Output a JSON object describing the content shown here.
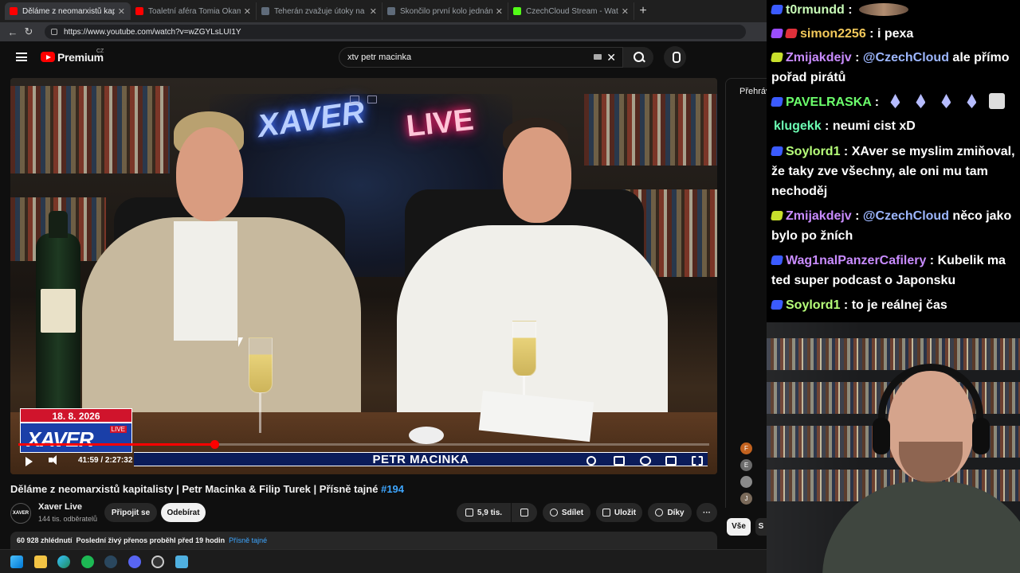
{
  "browser": {
    "tabs": [
      {
        "title": "Děláme z neomarxistů kapitalisty | Petr",
        "favicon_color": "#ff0000",
        "active": true
      },
      {
        "title": "Toaletní aféra Tomia Okamury. Co",
        "favicon_color": "#ff0000",
        "active": false
      },
      {
        "title": "Teherán zvažuje útoky na vojensk",
        "favicon_color": "#5f6b7a",
        "active": false
      },
      {
        "title": "Skončilo první kolo jednání minist",
        "favicon_color": "#5f6b7a",
        "active": false
      },
      {
        "title": "CzechCloud Stream - Watch Live o",
        "favicon_color": "#53fc18",
        "active": false
      }
    ],
    "url": "https://www.youtube.com/watch?v=wZGYLsLUI1Y"
  },
  "youtube": {
    "brand": "Premium",
    "region": "CZ",
    "search_value": "xtv petr macinka"
  },
  "player": {
    "overlay": {
      "date": "18. 8. 2026",
      "show_logo": "XAVER",
      "show_logo_tag": "LIVE",
      "guest_name": "PETR MACINKA",
      "neon_left": "XAVER",
      "neon_right": "LIVE"
    },
    "time_display": "41:59 / 2:27:32",
    "progress_fraction": 0.284
  },
  "video": {
    "title": "Děláme z neomarxistů kapitalisty | Petr Macinka & Filip Turek | Přísně tajné",
    "hashtag": "#194",
    "channel": {
      "name": "Xaver Live",
      "subscribers": "144 tis. odběratelů",
      "avatar_text": "XAVER"
    },
    "join_label": "Připojit se",
    "subscribe_label": "Odebírat",
    "likes": "5,9 tis.",
    "share_label": "Sdílet",
    "save_label": "Uložit",
    "thanks_label": "Díky",
    "more_label": "···",
    "description": {
      "views": "60 928 zhlédnutí",
      "stream_info": "Poslední živý přenos proběhl před 19 hodin",
      "tag": "Přísně tajné"
    }
  },
  "sidebar": {
    "label": "Přehráv",
    "avatars": [
      "F",
      "E",
      "",
      "J"
    ],
    "chip_all": "Vše",
    "chip_next": "S"
  },
  "chat": {
    "messages": [
      {
        "user": "t0rmundd",
        "user_color": "#c8fbb7",
        "badge_color": "#3b5bff",
        "text": ""
      },
      {
        "user": "simon2256",
        "user_color": "#f2c85a",
        "badge_color": "#9b4dff",
        "text": "i pexa"
      },
      {
        "user": "Zmijakdejv",
        "user_color": "#c98cff",
        "badge_color": "#c8e02c",
        "mention": "@CzechCloud",
        "text": "ale přímo pořad pirátů"
      },
      {
        "user": "PAVELRASKA",
        "user_color": "#6cff6c",
        "badge_color": "#3b5bff",
        "text": ""
      },
      {
        "user": "klugekk",
        "user_color": "#6cffb3",
        "badge_color": "",
        "text": "neumi cist xD"
      },
      {
        "user": "Soylord1",
        "user_color": "#b7ff7a",
        "badge_color": "#3b5bff",
        "text": "XAver se myslim zmiňoval, že taky zve všechny, ale oni mu tam nechoděj"
      },
      {
        "user": "Zmijakdejv",
        "user_color": "#c98cff",
        "badge_color": "#c8e02c",
        "mention": "@CzechCloud",
        "text": "něco jako bylo po žních"
      },
      {
        "user": "Wag1nalPanzerCafilery",
        "user_color": "#c98cff",
        "badge_color": "#3b5bff",
        "text": "Kubelik ma ted super podcast o Japonsku"
      },
      {
        "user": "Soylord1",
        "user_color": "#b7ff7a",
        "badge_color": "#3b5bff",
        "text": "to je reálnej čas"
      }
    ]
  }
}
